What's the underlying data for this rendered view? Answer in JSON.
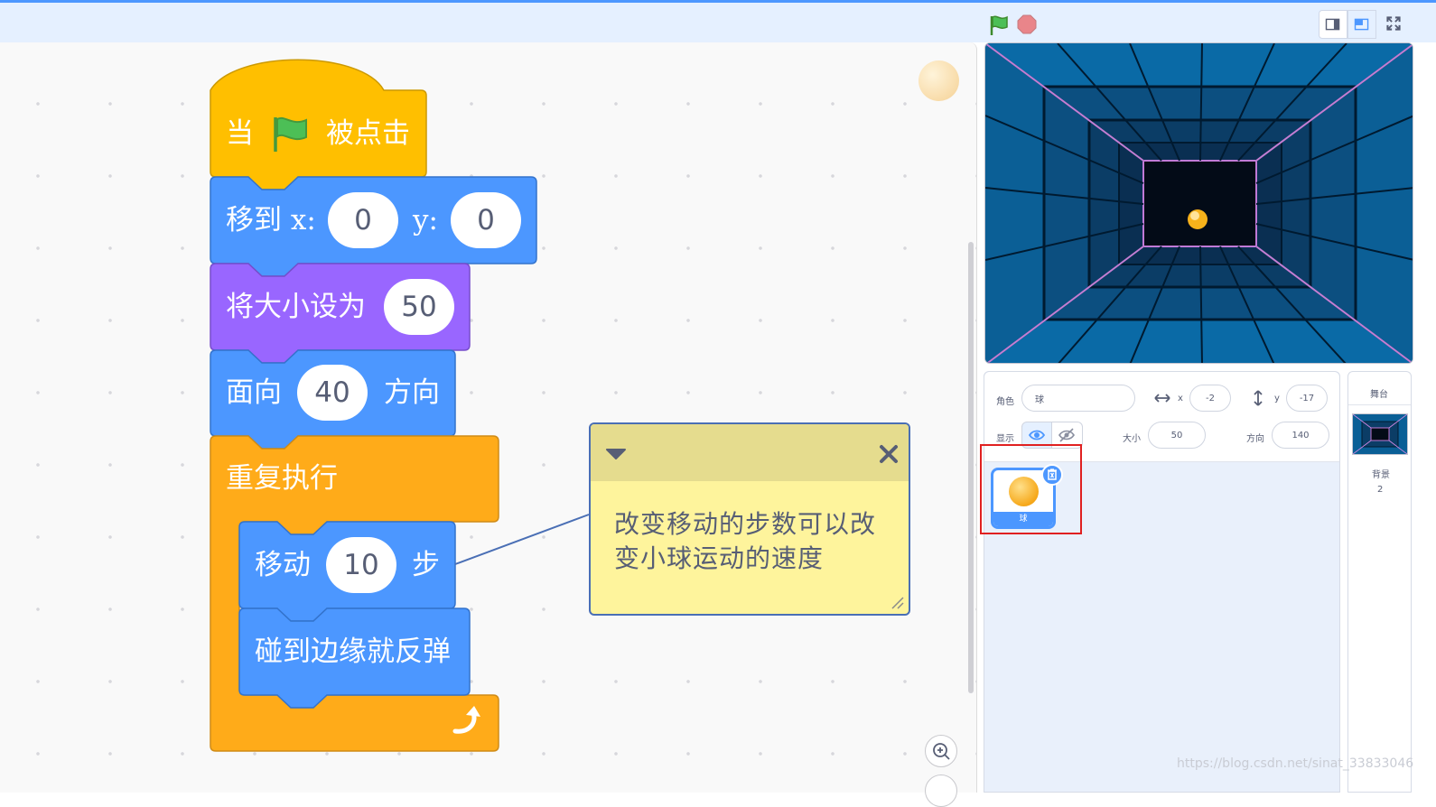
{
  "workspace": {
    "blocks": {
      "hat": {
        "prefix": "当",
        "suffix": "被点击"
      },
      "goto": {
        "label": "移到 x:",
        "x_value": "0",
        "y_label": "y:",
        "y_value": "0"
      },
      "set_size": {
        "label": "将大小设为",
        "value": "50"
      },
      "point": {
        "label": "面向",
        "value": "40",
        "suffix": "方向"
      },
      "forever": {
        "label": "重复执行"
      },
      "move": {
        "label": "移动",
        "value": "10",
        "suffix": "步"
      },
      "bounce": {
        "label": "碰到边缘就反弹"
      }
    },
    "comment": {
      "text": "改变移动的步数可以改变小球运动的速度"
    }
  },
  "sprite_info": {
    "sprite_label": "角色",
    "sprite_name": "球",
    "x_label": "x",
    "x_value": "-2",
    "y_label": "y",
    "y_value": "-17",
    "show_label": "显示",
    "size_label": "大小",
    "size_value": "50",
    "direction_label": "方向",
    "direction_value": "140"
  },
  "sprite_list": [
    {
      "name": "球"
    }
  ],
  "stage_pane": {
    "title": "舞台",
    "backdrop_label": "背景",
    "backdrop_count": "2"
  },
  "watermark": "https://blog.csdn.net/sinat_33833046",
  "colors": {
    "events": "#ffbf00",
    "motion": "#4c97ff",
    "looks": "#9966ff",
    "control": "#ffab19",
    "highlight_box": "#e02020"
  },
  "icons": [
    "green-flag-icon",
    "stop-icon",
    "small-stage-icon",
    "normal-stage-icon",
    "fullscreen-icon",
    "eye-icon",
    "eye-hidden-icon",
    "delete-icon",
    "zoom-in-icon",
    "collapse-icon",
    "close-icon",
    "loop-arrow-icon"
  ]
}
